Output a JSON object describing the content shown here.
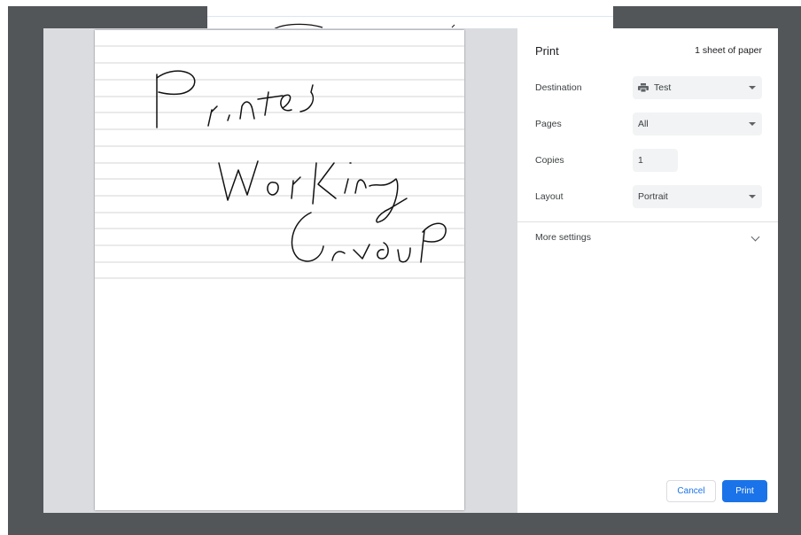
{
  "print_dialog": {
    "title": "Print",
    "sheet_count": "1 sheet of paper",
    "destination": {
      "label": "Destination",
      "value": "Test",
      "icon": "printer-icon"
    },
    "pages": {
      "label": "Pages",
      "value": "All"
    },
    "copies": {
      "label": "Copies",
      "value": "1"
    },
    "layout": {
      "label": "Layout",
      "value": "Portrait"
    },
    "more_settings": {
      "label": "More settings",
      "icon": "chevron-down-icon"
    },
    "buttons": {
      "cancel": "Cancel",
      "print": "Print"
    },
    "colors": {
      "accent": "#1a73e8",
      "backdrop": "#525659",
      "preview_bg": "#dadce0"
    }
  },
  "preview": {
    "handwritten_lines": [
      "Printed",
      "Working",
      "Group"
    ]
  }
}
